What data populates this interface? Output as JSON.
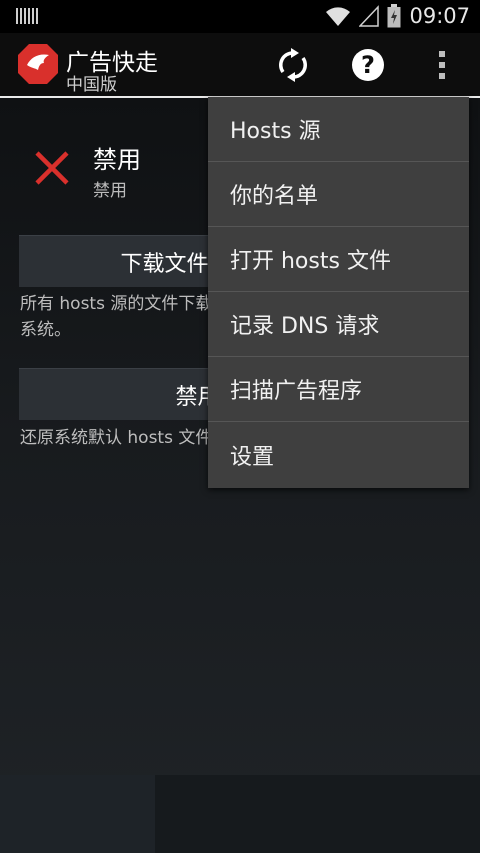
{
  "status_bar": {
    "time": "09:07"
  },
  "app_bar": {
    "title": "广告快走",
    "subtitle": "中国版",
    "icons": [
      "app-logo-icon",
      "refresh-icon",
      "help-icon",
      "overflow-menu-icon"
    ]
  },
  "status": {
    "title": "禁用",
    "subtitle": "禁用"
  },
  "download_button": {
    "label": "下载文件并应用广告拦截"
  },
  "download_desc": "所有 hosts 源的文件下载并应用到\n系统。",
  "disable_button": {
    "label": "禁用广告拦截"
  },
  "disable_desc": "还原系统默认 hosts 文件",
  "menu": {
    "items": [
      {
        "label": "Hosts 源"
      },
      {
        "label": "你的名单"
      },
      {
        "label": "打开 hosts 文件"
      },
      {
        "label": "记录 DNS 请求"
      },
      {
        "label": "扫描广告程序"
      },
      {
        "label": "设置"
      }
    ]
  },
  "colors": {
    "accent_red": "#d9302c",
    "menu_bg": "#3f3f3f"
  }
}
